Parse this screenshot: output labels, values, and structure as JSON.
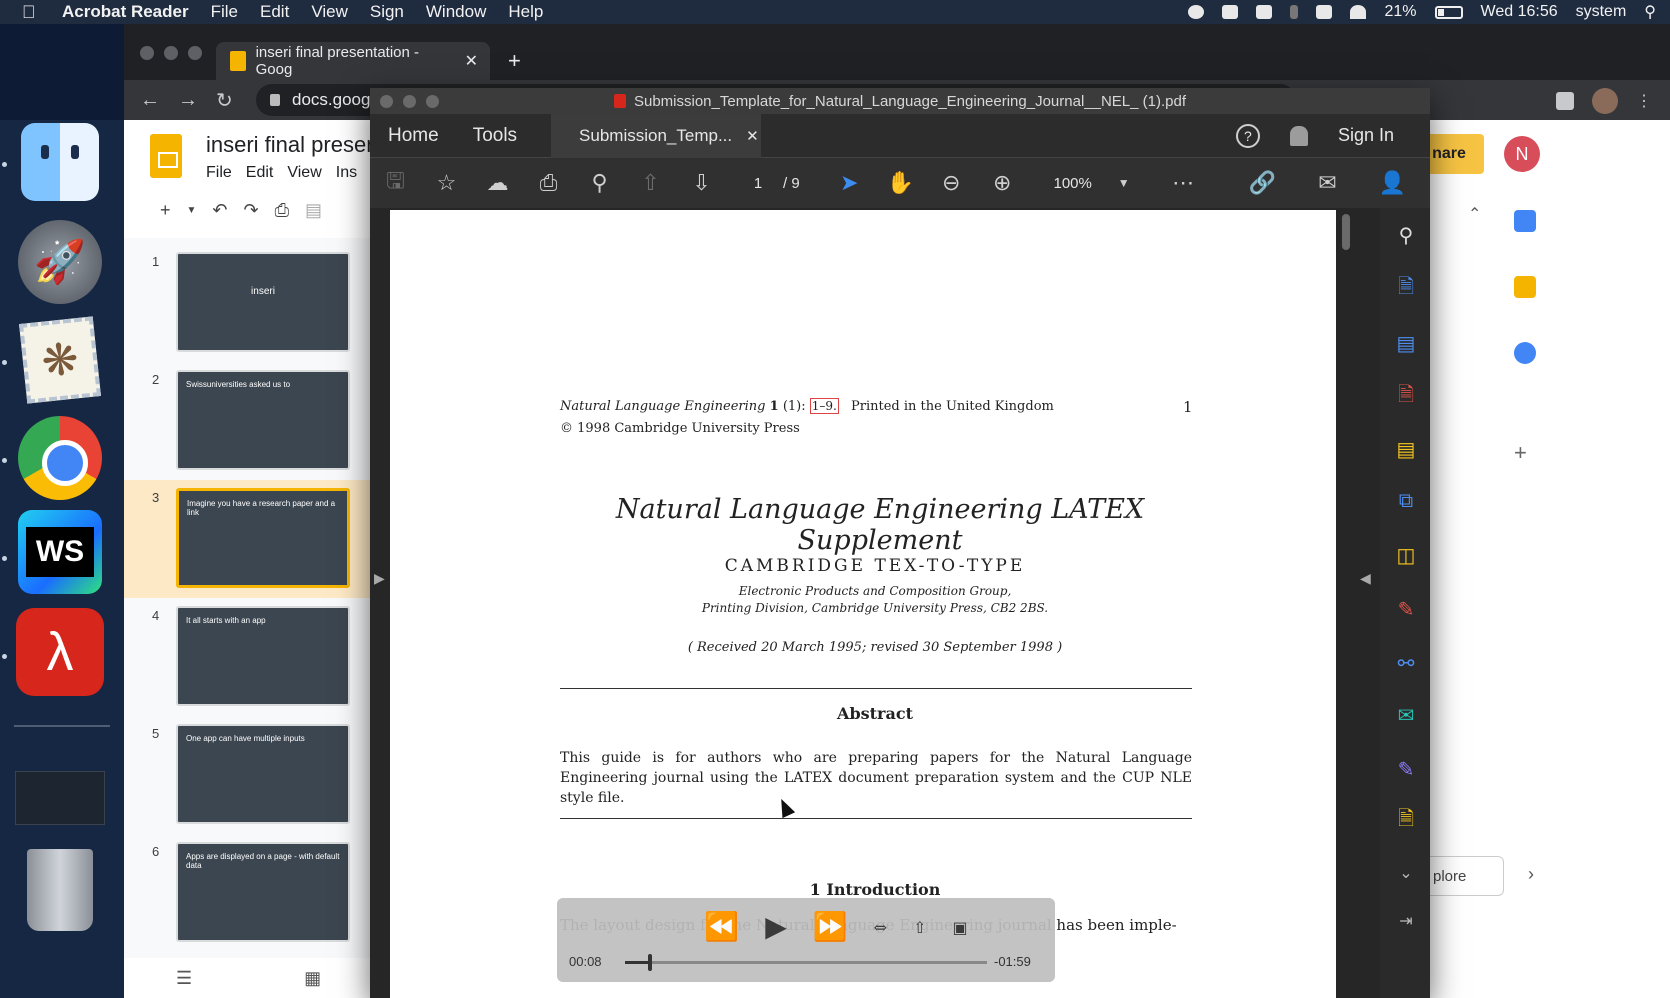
{
  "menubar": {
    "app_name": "Acrobat Reader",
    "items": [
      "File",
      "Edit",
      "View",
      "Sign",
      "Window",
      "Help"
    ],
    "battery": "21%",
    "clock": "Wed 16:56",
    "user": "system"
  },
  "browser": {
    "tab_title": "inseri final presentation - Goog",
    "url": "docs.goog",
    "slides": {
      "doc_title": "inseri final presen",
      "menu": [
        "File",
        "Edit",
        "View",
        "Ins"
      ],
      "share_label": "nare",
      "avatar_letter": "N",
      "explore_label": "plore",
      "thumbs": [
        {
          "num": "1",
          "title": "inseri"
        },
        {
          "num": "2",
          "title": "Swissuniversities asked us to"
        },
        {
          "num": "3",
          "title": "Imagine you have a research paper and a link"
        },
        {
          "num": "4",
          "title": "It all starts with an app"
        },
        {
          "num": "5",
          "title": "One app can have multiple inputs"
        },
        {
          "num": "6",
          "title": "Apps are displayed on a page - with default data"
        }
      ]
    }
  },
  "acrobat": {
    "window_title": "Submission_Template_for_Natural_Language_Engineering_Journal__NEL_ (1).pdf",
    "home_tab": "Home",
    "tools_tab": "Tools",
    "doc_tab": "Submission_Temp...",
    "sign_in": "Sign In",
    "page_current": "1",
    "page_total": "/ 9",
    "zoom": "100%"
  },
  "pdf": {
    "journal": "Natural Language Engineering",
    "volume": "1",
    "issue": "(1):",
    "pages": "1–9.",
    "printed": "Printed in the United Kingdom",
    "page_number": "1",
    "copyright": "© 1998 Cambridge University Press",
    "title": "Natural Language Engineering LATEX Supplement",
    "authors": "CAMBRIDGE TEX-TO-TYPE",
    "affiliation_1": "Electronic Products and Composition Group,",
    "affiliation_2": "Printing Division, Cambridge University Press, CB2 2BS.",
    "received": "( Received 20 March 1995; revised 30 September 1998 )",
    "abstract_heading": "Abstract",
    "abstract_text": "This guide is for authors who are preparing papers for the Natural Language Engineering journal using the LATEX document preparation system and the CUP NLE style file.",
    "section_heading": "1  Introduction",
    "intro_text": "The layout design for the Natural Language Engineering journal has been imple-"
  },
  "video": {
    "elapsed": "00:08",
    "remaining": "-01:59",
    "progress": 0.07
  }
}
